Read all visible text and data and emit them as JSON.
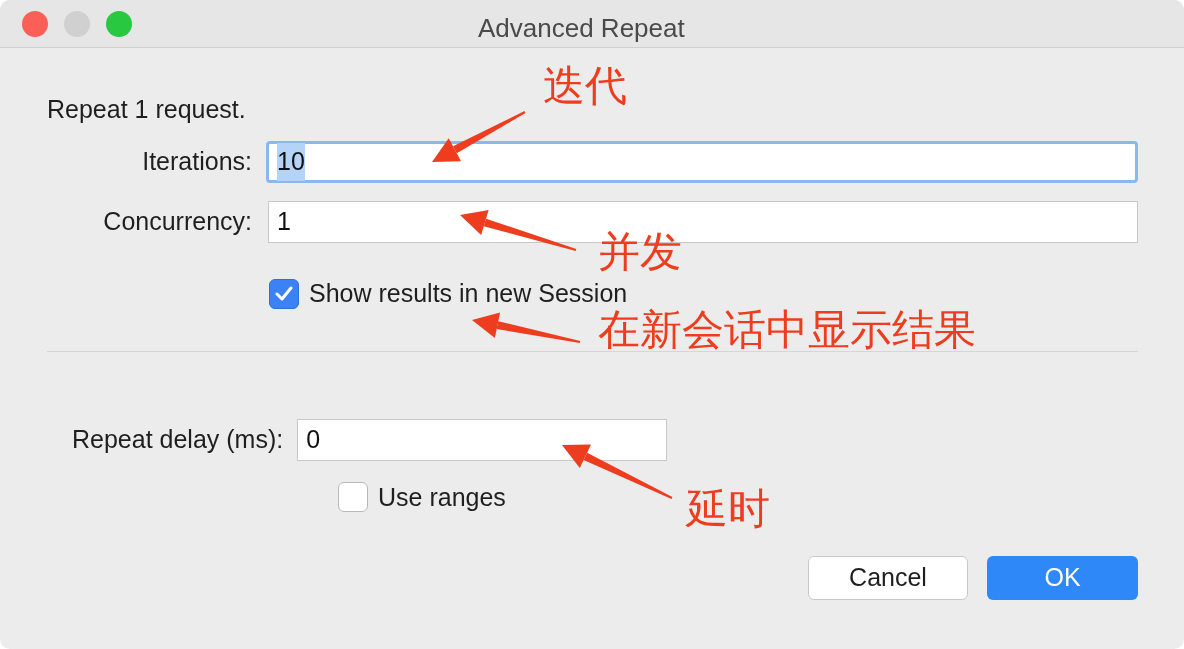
{
  "window": {
    "title": "Advanced Repeat"
  },
  "intro": "Repeat 1 request.",
  "fields": [
    {
      "label": "Iterations:",
      "value": "10",
      "focused": true
    },
    {
      "label": "Concurrency:",
      "value": "1",
      "focused": false
    }
  ],
  "show_results": {
    "label": "Show results in new Session",
    "checked": true
  },
  "delay": {
    "label": "Repeat delay (ms):",
    "value": "0"
  },
  "use_ranges": {
    "label": "Use ranges",
    "checked": false
  },
  "buttons": [
    {
      "label": "Cancel",
      "kind": "secondary"
    },
    {
      "label": "OK",
      "kind": "primary"
    }
  ],
  "annotations": [
    {
      "text": "迭代"
    },
    {
      "text": "并发"
    },
    {
      "text": "在新会话中显示结果"
    },
    {
      "text": "延时"
    }
  ]
}
